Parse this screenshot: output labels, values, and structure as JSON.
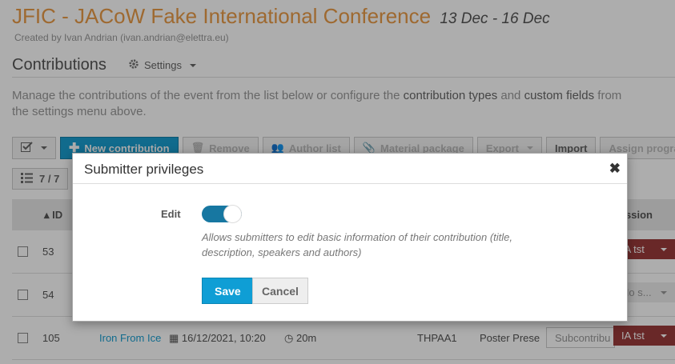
{
  "event": {
    "title": "JFIC - JACoW Fake International Conference",
    "dates": "13 Dec - 16 Dec",
    "creator": "Created by Ivan Andrian (ivan.andrian@elettra.eu)"
  },
  "section": {
    "title": "Contributions",
    "settings_label": "Settings",
    "description_start": "Manage the contributions of the event from the list below or configure the ",
    "description_link1": "contribution types",
    "description_mid": " and ",
    "description_link2": "custom fields",
    "description_end": " from the settings menu above."
  },
  "toolbar": {
    "new_contribution": "New contribution",
    "remove": "Remove",
    "author_list": "Author list",
    "material_package": "Material package",
    "export": "Export",
    "import": "Import",
    "assign_program": "Assign programm"
  },
  "list": {
    "count": "7 / 7",
    "headers": {
      "id": "ID",
      "session": "ssion"
    },
    "rows": [
      {
        "id": "53",
        "title": "",
        "date": "",
        "duration": "",
        "code": "",
        "type": "",
        "subcontribution": "",
        "session": "IA tst",
        "session_style": "red"
      },
      {
        "id": "54",
        "title": "",
        "date": "",
        "duration": "",
        "code": "",
        "type": "",
        "subcontribution": "",
        "session": "No s...",
        "session_style": "grey"
      },
      {
        "id": "105",
        "title": "Iron From Ice",
        "date": "16/12/2021, 10:20",
        "duration": "20m",
        "code": "THPAA1",
        "type": "Poster Prese",
        "subcontribution": "Subcontribu",
        "session": "IA tst",
        "session_style": "red"
      }
    ]
  },
  "dialog": {
    "title": "Submitter privileges",
    "field_label": "Edit",
    "toggle_on": true,
    "help": "Allows submitters to edit basic information of their contribution (title, description, speakers and authors)",
    "save": "Save",
    "cancel": "Cancel"
  },
  "colors": {
    "accent": "#1a9ed0",
    "title_orange": "#e99b47",
    "session_red": "#9b3b3b"
  }
}
